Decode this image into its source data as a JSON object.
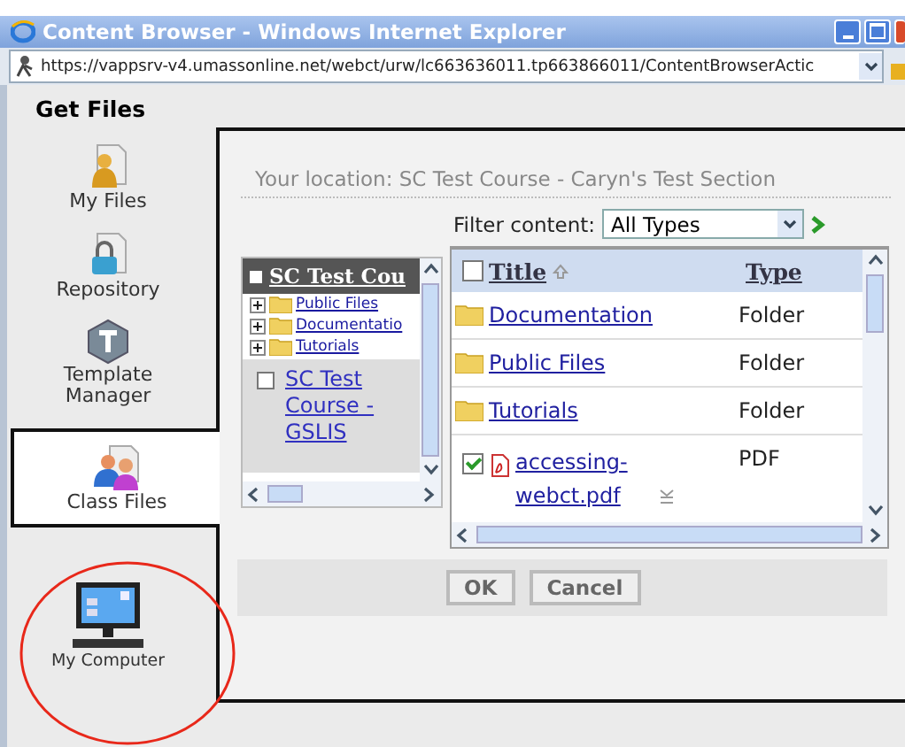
{
  "window": {
    "title": "Content Browser - Windows Internet Explorer",
    "url": "https://vappsrv-v4.umassonline.net/webct/urw/lc663636011.tp663866011/ContentBrowserActic"
  },
  "heading": "Get Files",
  "sidebar": {
    "items": [
      {
        "label": "My Files",
        "kind": "user",
        "selected": false
      },
      {
        "label": "Repository",
        "kind": "lock",
        "selected": false
      },
      {
        "label": "Template Manager",
        "kind": "template",
        "selected": false
      },
      {
        "label": "Class Files",
        "kind": "people",
        "selected": true
      },
      {
        "label": "My Computer",
        "kind": "computer",
        "selected": false
      }
    ]
  },
  "location": "Your location: SC Test Course - Caryn's Test Section",
  "filter": {
    "label": "Filter content:",
    "value": "All Types"
  },
  "tree": {
    "header": "SC Test Cou",
    "items": [
      {
        "label": "Public Files",
        "expanded": false
      },
      {
        "label": "Documentatio",
        "expanded": false
      },
      {
        "label": "Tutorials",
        "expanded": false
      }
    ],
    "node": {
      "label": "SC Test Course - GSLIS",
      "checked": false
    }
  },
  "table": {
    "columns": [
      "Title",
      "Type"
    ],
    "header_checked": false,
    "rows": [
      {
        "title": "Documentation",
        "type": "Folder",
        "kind": "folder"
      },
      {
        "title": "Public Files",
        "type": "Folder",
        "kind": "folder"
      },
      {
        "title": "Tutorials",
        "type": "Folder",
        "kind": "folder"
      },
      {
        "title": "accessing-webct.pdf",
        "type": "PDF",
        "kind": "pdf",
        "checked": true
      }
    ]
  },
  "buttons": [
    "OK",
    "Cancel"
  ]
}
